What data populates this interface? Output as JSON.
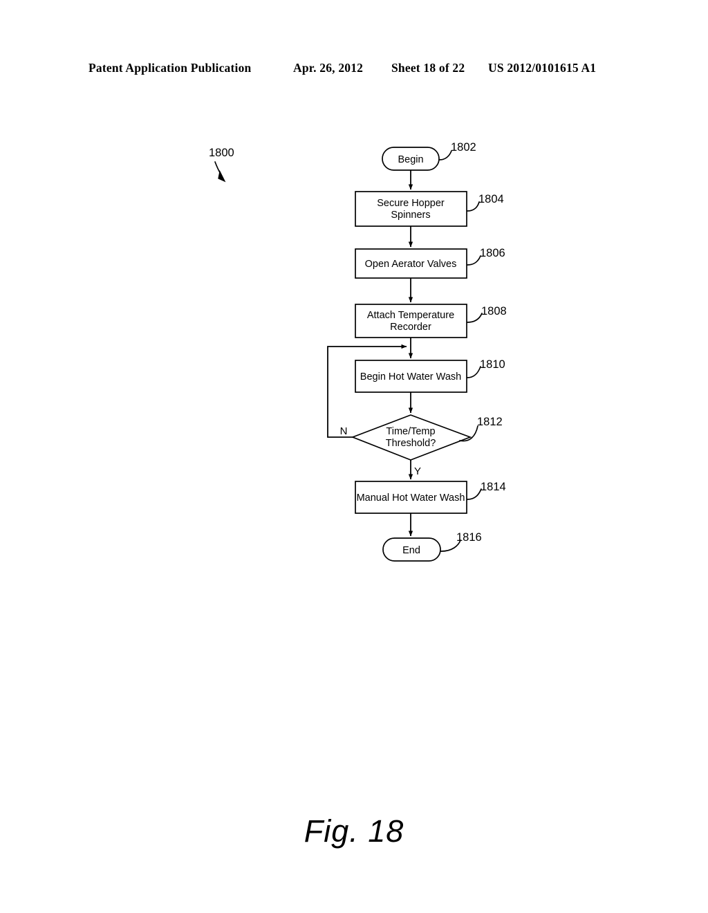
{
  "header": {
    "publication": "Patent Application Publication",
    "date": "Apr. 26, 2012",
    "sheet": "Sheet 18 of 22",
    "patent_number": "US 2012/0101615 A1"
  },
  "figure": {
    "caption": "Fig. 18",
    "diagram_ref": "1800",
    "nodes": [
      {
        "ref": "1802",
        "label": "Begin",
        "shape": "terminator"
      },
      {
        "ref": "1804",
        "label": "Secure Hopper\nSpinners",
        "line1": "Secure Hopper",
        "line2": "Spinners",
        "shape": "process"
      },
      {
        "ref": "1806",
        "label": "Open Aerator Valves",
        "shape": "process"
      },
      {
        "ref": "1808",
        "label": "Attach Temperature\nRecorder",
        "line1": "Attach Temperature",
        "line2": "Recorder",
        "shape": "process"
      },
      {
        "ref": "1810",
        "label": "Begin Hot Water Wash",
        "shape": "process"
      },
      {
        "ref": "1812",
        "label": "Time/Temp\nThreshold?",
        "line1": "Time/Temp",
        "line2": "Threshold?",
        "shape": "decision"
      },
      {
        "ref": "1814",
        "label": "Manual Hot Water Wash",
        "shape": "process"
      },
      {
        "ref": "1816",
        "label": "End",
        "shape": "terminator"
      }
    ],
    "branch_labels": {
      "no": "N",
      "yes": "Y"
    }
  },
  "colors": {
    "ink": "#000000",
    "paper": "#ffffff"
  }
}
